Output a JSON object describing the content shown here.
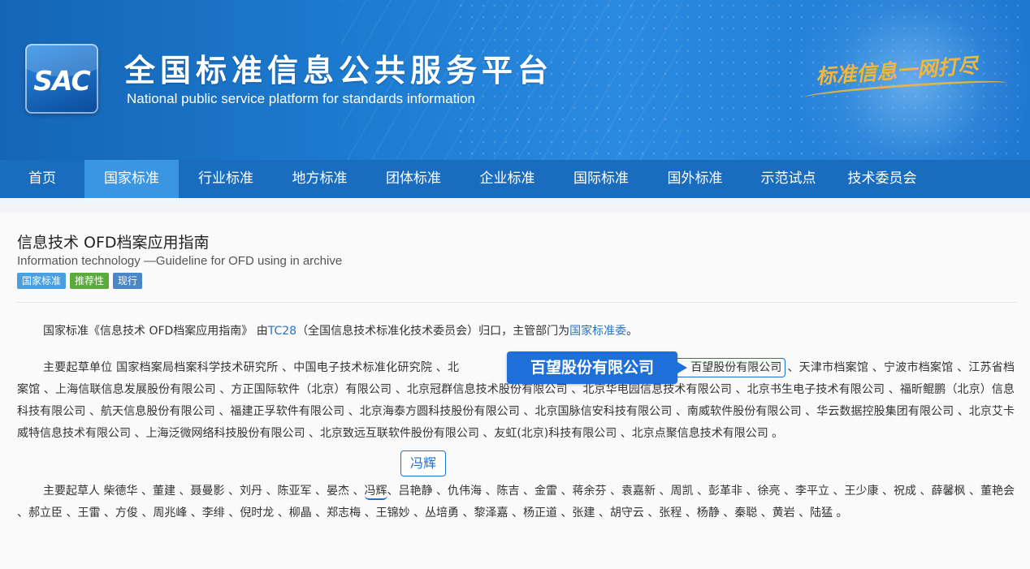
{
  "header": {
    "logo_text": "SAC",
    "site_title": "全国标准信息公共服务平台",
    "site_subtitle": "National public service platform  for standards information",
    "slogan": "标准信息一网打尽"
  },
  "nav": {
    "items": [
      {
        "label": "首页"
      },
      {
        "label": "国家标准"
      },
      {
        "label": "行业标准"
      },
      {
        "label": "地方标准"
      },
      {
        "label": "团体标准"
      },
      {
        "label": "企业标准"
      },
      {
        "label": "国际标准"
      },
      {
        "label": "国外标准"
      },
      {
        "label": "示范试点"
      },
      {
        "label": "技术委员会"
      }
    ],
    "active_index": 1
  },
  "standard": {
    "title_cn": "信息技术 OFD档案应用指南",
    "title_en": "Information technology —Guideline for OFD using in archive",
    "tags": [
      "国家标准",
      "推荐性",
      "现行"
    ]
  },
  "summary": {
    "prefix": "国家标准《信息技术 OFD档案应用指南》 由",
    "tc_link": "TC28",
    "tc_name": "（全国信息技术标准化技术委员会）归口，主管部门为",
    "authority_link": "国家标准委",
    "suffix": "。"
  },
  "drafting_units": {
    "label": "主要起草单位",
    "before_overlay": " 国家档案局档案科学技术研究所 、中国电子技术标准化研究院 、北",
    "highlighted": "百望股份有限公司",
    "after": "、天津市档案馆 、宁波市档案馆 、江苏省档案馆 、上海信联信息发展股份有限公司 、方正国际软件（北京）有限公司 、北京冠群信息技术股份有限公司 、北京华电园信息技术有限公司 、北京书生电子技术有限公司 、福昕鲲鹏（北京）信息科技有限公司 、航天信息股份有限公司 、福建正孚软件有限公司 、北京海泰方圆科技股份有限公司 、北京国脉信安科技有限公司 、南威软件股份有限公司 、华云数据控股集团有限公司 、北京艾卡威特信息技术有限公司 、上海泛微网络科技股份有限公司 、北京致远互联软件股份有限公司 、友虹(北京)科技有限公司 、北京点聚信息技术有限公司 。"
  },
  "drafters": {
    "label": "主要起草人",
    "before": " 柴德华 、董建 、聂曼影 、刘丹 、陈亚军 、晏杰 、",
    "highlighted": "冯辉",
    "after": "、吕艳静 、仇伟海 、陈吉 、金雷 、蒋余芬 、袁嘉新 、周凯 、彭革非 、徐亮 、李平立 、王少康 、祝成 、薛馨枫 、董艳会 、郝立臣 、王雷 、方俊 、周兆峰 、李绯 、倪时龙 、柳晶 、郑志梅 、王锦妙 、丛培勇 、黎泽嘉 、杨正道 、张建 、胡守云 、张程 、杨静 、秦聪 、黄岩 、陆猛 。"
  },
  "annotations": {
    "company_callout": "百望股份有限公司",
    "person_callout": "冯辉"
  },
  "colors": {
    "banner": "#1d7bd0",
    "nav": "#1a6cbe",
    "nav_active": "#3a95e2",
    "link": "#2a72c3",
    "callout": "#1f6fd9",
    "slogan": "#f3b63c"
  }
}
